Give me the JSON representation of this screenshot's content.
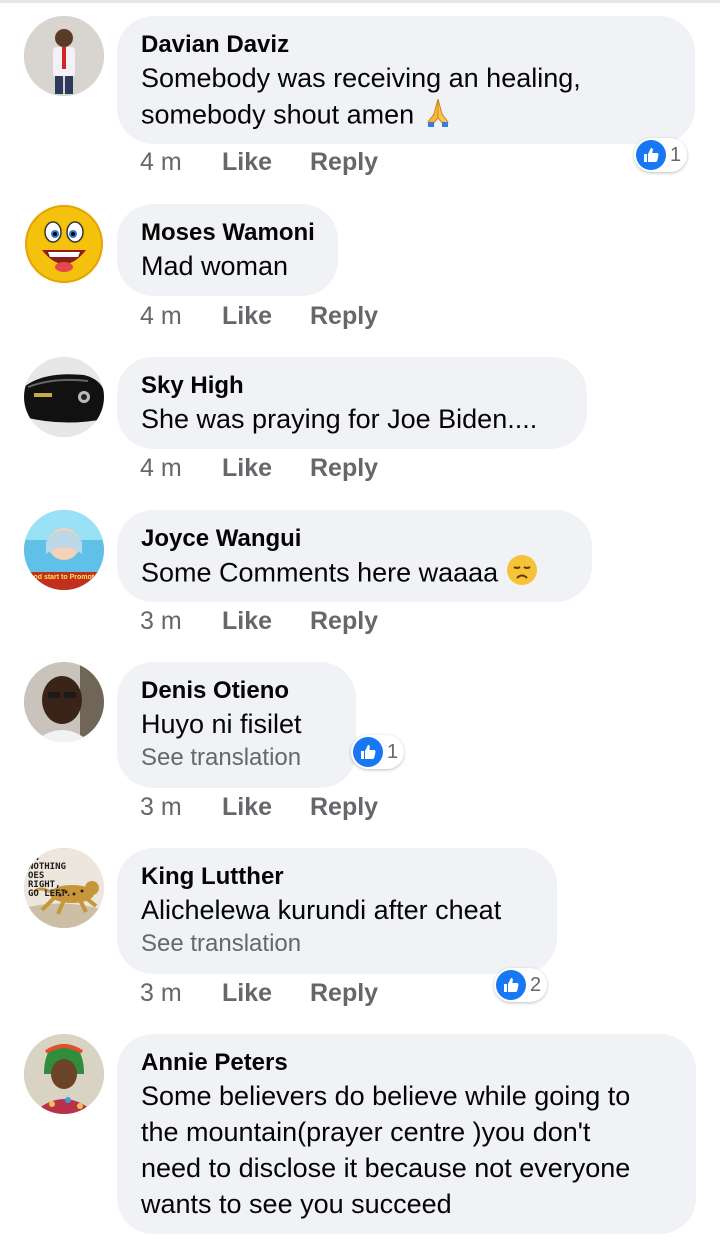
{
  "colors": {
    "bubble": "#f0f2f5",
    "meta_text": "#65676b",
    "like_blue": "#1877f2"
  },
  "comments": [
    {
      "author": "Davian Daviz",
      "lines": [
        "Somebody was receiving an healing,",
        "somebody shout amen"
      ],
      "emoji": "folded-hands",
      "time": "4 m",
      "like": "Like",
      "reply": "Reply",
      "reaction_count": "1",
      "avatar": "man-in-shirt-avatar"
    },
    {
      "author": "Moses Wamoni",
      "lines": [
        "Mad woman"
      ],
      "time": "4 m",
      "like": "Like",
      "reply": "Reply",
      "avatar": "grinning-emoji-avatar"
    },
    {
      "author": "Sky High",
      "lines": [
        "She was praying for Joe Biden...."
      ],
      "time": "4 m",
      "like": "Like",
      "reply": "Reply",
      "avatar": "car-avatar"
    },
    {
      "author": "Joyce Wangui",
      "lines": [
        "Some Comments here waaaa"
      ],
      "emoji": "disappointed-face",
      "time": "3 m",
      "like": "Like",
      "reply": "Reply",
      "avatar": "woman-in-hijab-avatar",
      "avatar_caption": "God start to Promote"
    },
    {
      "author": "Denis Otieno",
      "lines": [
        "Huyo ni fisilet"
      ],
      "translation": "See translation",
      "time": "3 m",
      "like": "Like",
      "reply": "Reply",
      "reaction_count": "1",
      "avatar": "man-selfie-avatar"
    },
    {
      "author": "King Lutther",
      "lines": [
        "Alichelewa kurundi after cheat"
      ],
      "translation": "See translation",
      "time": "3 m",
      "like": "Like",
      "reply": "Reply",
      "reaction_count": "2",
      "avatar": "cheetah-avatar",
      "avatar_caption": "EN NOTHING OES RIGHT, GO LEFT."
    },
    {
      "author": "Annie Peters",
      "lines": [
        "Some believers do believe while going to",
        "the mountain(prayer centre )you don't",
        "need to disclose it because not everyone",
        "wants to see you succeed"
      ],
      "avatar": "woman-headscarf-avatar"
    }
  ]
}
